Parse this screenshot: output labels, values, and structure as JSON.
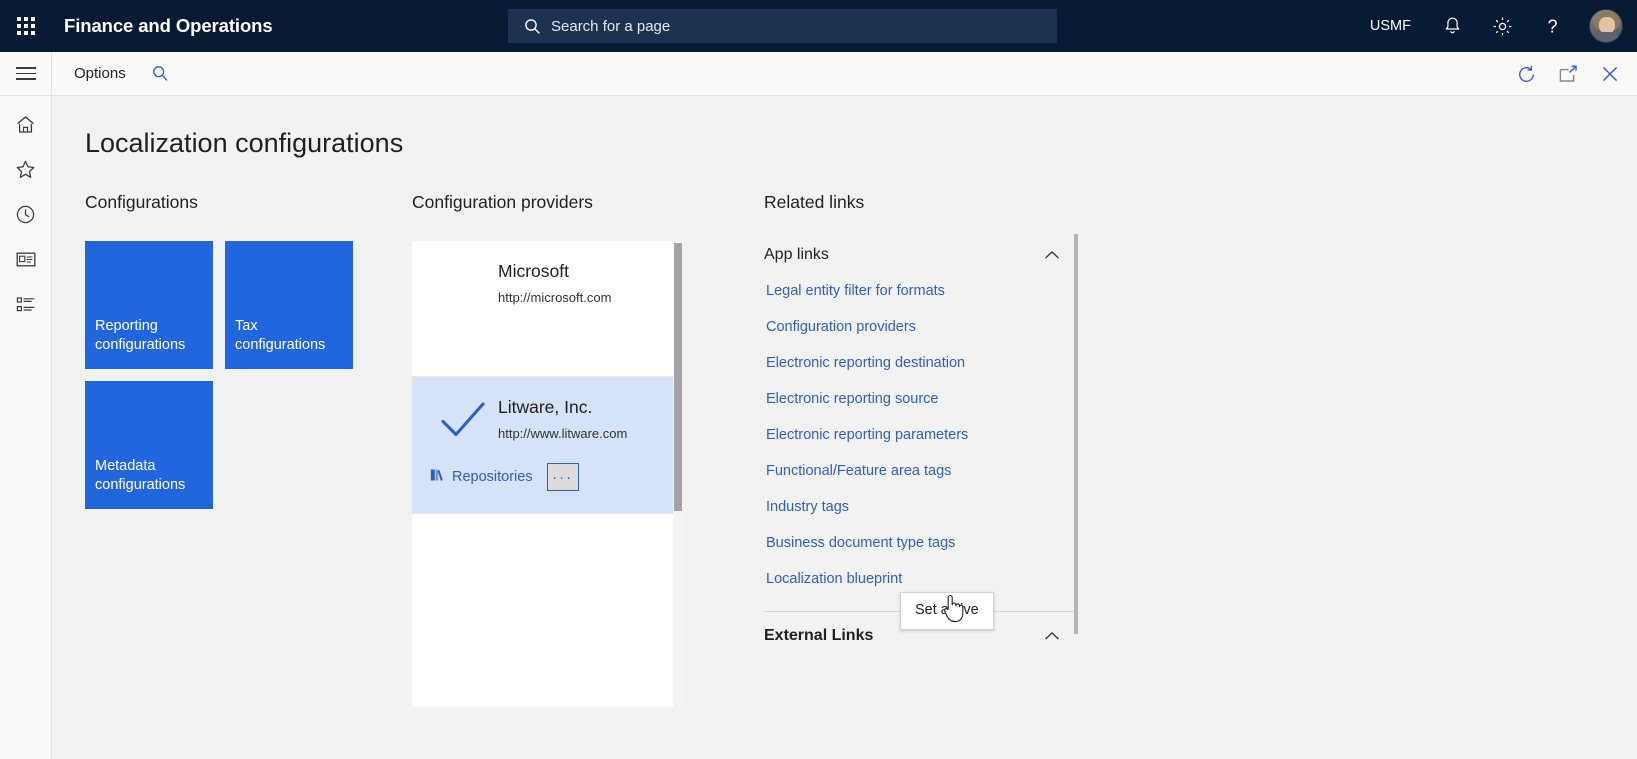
{
  "topbar": {
    "waffle_icon": "app-launcher-icon",
    "app_title": "Finance and Operations",
    "search_placeholder": "Search for a page",
    "search_icon": "search-icon",
    "company": "USMF",
    "notification_icon": "bell-icon",
    "settings_icon": "gear-icon",
    "help_icon": "question-mark-icon",
    "avatar": "user-avatar"
  },
  "subbar": {
    "menu_icon": "hamburger-icon",
    "options_label": "Options",
    "search_icon": "search-icon",
    "refresh_icon": "refresh-icon",
    "popout_icon": "open-in-new-window-icon",
    "close_icon": "close-icon"
  },
  "rail": {
    "items": [
      {
        "name": "home",
        "icon": "home-icon"
      },
      {
        "name": "favorites",
        "icon": "star-icon"
      },
      {
        "name": "recent",
        "icon": "clock-icon"
      },
      {
        "name": "workspaces",
        "icon": "workspace-icon"
      },
      {
        "name": "modules",
        "icon": "list-icon"
      }
    ]
  },
  "page": {
    "title": "Localization configurations"
  },
  "configurations": {
    "heading": "Configurations",
    "tile_color": "#2266dd",
    "tiles": [
      {
        "label": "Reporting configurations"
      },
      {
        "label": "Tax configurations"
      },
      {
        "label": "Metadata configurations"
      }
    ]
  },
  "providers": {
    "heading": "Configuration providers",
    "items": [
      {
        "name": "Microsoft",
        "url": "http://microsoft.com",
        "active": false
      },
      {
        "name": "Litware, Inc.",
        "url": "http://www.litware.com",
        "active": true,
        "repositories_label": "Repositories",
        "repositories_icon": "books-icon",
        "ellipsis_label": "···"
      }
    ],
    "active_color": "#d5e2f8",
    "check_color": "#2f5fc4"
  },
  "context_menu": {
    "items": [
      {
        "label": "Set active"
      }
    ]
  },
  "related": {
    "heading": "Related links",
    "groups": [
      {
        "title": "App links",
        "collapse_icon": "chevron-up-icon",
        "links": [
          "Legal entity filter for formats",
          "Configuration providers",
          "Electronic reporting destination",
          "Electronic reporting source",
          "Electronic reporting parameters",
          "Functional/Feature area tags",
          "Industry tags",
          "Business document type tags",
          "Localization blueprint"
        ]
      },
      {
        "title": "External Links",
        "collapse_icon": "chevron-up-icon",
        "links": []
      }
    ],
    "link_color": "#2f5fc4"
  }
}
